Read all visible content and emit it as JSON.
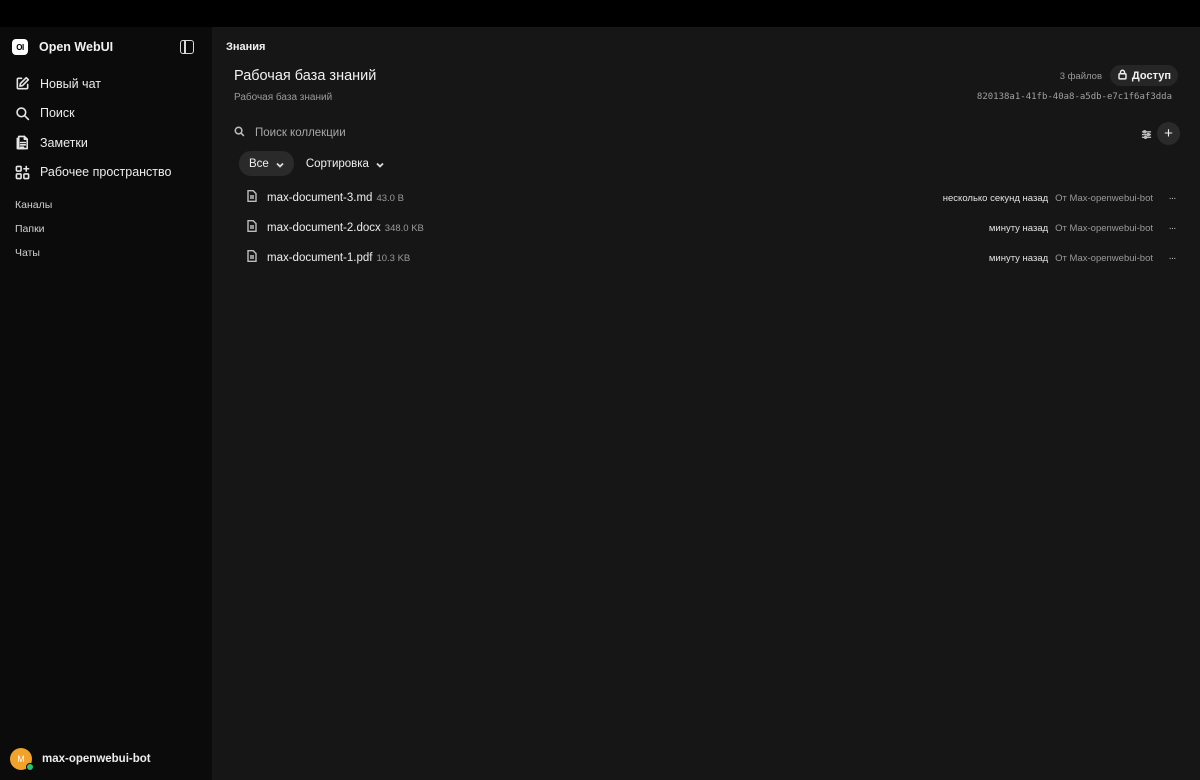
{
  "sidebar": {
    "brand_logo": "OI",
    "brand_name": "Open WebUI",
    "nav": [
      {
        "label": "Новый чат",
        "icon": "pencil-square-icon"
      },
      {
        "label": "Поиск",
        "icon": "search-icon"
      },
      {
        "label": "Заметки",
        "icon": "notes-icon"
      },
      {
        "label": "Рабочее пространство",
        "icon": "workspace-icon"
      }
    ],
    "sections": [
      "Каналы",
      "Папки",
      "Чаты"
    ],
    "user": {
      "initial": "M",
      "name": "max-openwebui-bot",
      "avatar_color": "#f1a22b",
      "status_color": "#28c76f"
    }
  },
  "main": {
    "page_title": "Знания",
    "kb_title": "Рабочая база знаний",
    "kb_subtitle": "Рабочая база знаний",
    "file_count": "3 файлов",
    "access_label": "Доступ",
    "kb_id": "820138a1-41fb-40a8-a5db-e7c1f6af3dda",
    "search_placeholder": "Поиск коллекции",
    "filter_all": "Все",
    "sort_label": "Сортировка",
    "files": [
      {
        "name": "max-document-3.md",
        "size": "43.0 B",
        "time": "несколько секунд назад",
        "author": "От Max-openwebui-bot"
      },
      {
        "name": "max-document-2.docx",
        "size": "348.0 KB",
        "time": "минуту назад",
        "author": "От Max-openwebui-bot"
      },
      {
        "name": "max-document-1.pdf",
        "size": "10.3 KB",
        "time": "минуту назад",
        "author": "От Max-openwebui-bot"
      }
    ],
    "more_label": "···"
  },
  "colors": {
    "sidebar_bg": "#0b0b0b",
    "main_bg": "#161616",
    "accent_chip": "#2a2a2a"
  }
}
